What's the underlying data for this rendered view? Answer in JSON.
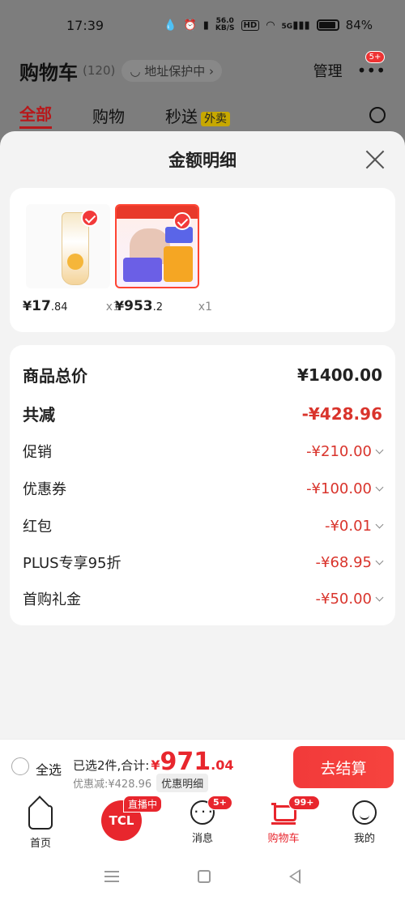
{
  "status_bar": {
    "time": "17:39",
    "net_speed_top": "56.0",
    "net_speed_bottom": "KB/S",
    "hd": "HD",
    "signal": "5G",
    "battery": "84%"
  },
  "header": {
    "title": "购物车",
    "count": "(120)",
    "address_protect": "地址保护中",
    "manage": "管理",
    "more_badge": "5+"
  },
  "tabs": {
    "all": "全部",
    "shopping": "购物",
    "flash": "秒送",
    "takeout": "外卖"
  },
  "sheet": {
    "title": "金额明细",
    "products": [
      {
        "yen": "¥",
        "price_int": "17",
        "price_dec": ".84",
        "qty": "x1"
      },
      {
        "yen": "¥",
        "price_int": "953",
        "price_dec": ".2",
        "qty": "x1"
      }
    ],
    "breakdown": [
      {
        "label": "商品总价",
        "value": "¥1400.00"
      },
      {
        "label": "共减",
        "value": "-¥428.96"
      },
      {
        "label": "促销",
        "value": "-¥210.00"
      },
      {
        "label": "优惠券",
        "value": "-¥100.00"
      },
      {
        "label": "红包",
        "value": "-¥0.01"
      },
      {
        "label": "PLUS专享95折",
        "value": "-¥68.95"
      },
      {
        "label": "首购礼金",
        "value": "-¥50.00"
      }
    ]
  },
  "checkout": {
    "select_all": "全选",
    "selected_text": "已选2件,合计:",
    "yen": "¥",
    "total_int": "971",
    "total_dec": ".04",
    "discount_text": "优惠减:¥428.96",
    "detail_button": "优惠明细",
    "submit": "去结算"
  },
  "bottom_nav": [
    {
      "label": "首页",
      "icon": "home-icon"
    },
    {
      "label": "",
      "icon": "tcl-logo",
      "logo_text": "TCL",
      "badge": "直播中"
    },
    {
      "label": "消息",
      "icon": "message-icon",
      "badge": "5+"
    },
    {
      "label": "购物车",
      "icon": "cart-icon",
      "badge": "99+"
    },
    {
      "label": "我的",
      "icon": "profile-icon"
    }
  ],
  "colors": {
    "accent": "#e8262d",
    "sheet_bg": "#f3f3f3",
    "overlay": "#7d7d7d"
  }
}
